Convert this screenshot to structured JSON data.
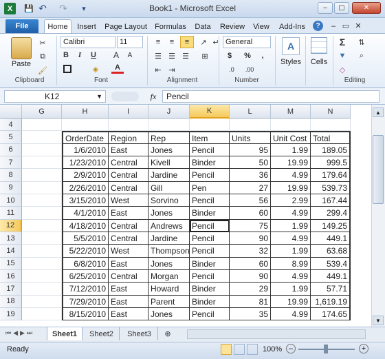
{
  "window": {
    "title": "Book1 - Microsoft Excel"
  },
  "quick_access": {
    "save": "💾",
    "undo": "↶",
    "redo": "↷",
    "customize": "▾"
  },
  "ribbon_tabs": [
    "File",
    "Home",
    "Insert",
    "Page Layout",
    "Formulas",
    "Data",
    "Review",
    "View",
    "Add-Ins"
  ],
  "ribbon": {
    "paste_label": "Paste",
    "font_name": "Calibri",
    "font_size": "11",
    "number_format": "General",
    "styles_label": "Styles",
    "cells_label": "Cells",
    "groups": [
      "Clipboard",
      "Font",
      "Alignment",
      "Number",
      "Editing"
    ]
  },
  "formula_bar": {
    "name_box": "K12",
    "fx": "fx",
    "value": "Pencil"
  },
  "columns": [
    "G",
    "H",
    "I",
    "J",
    "K",
    "L",
    "M",
    "N"
  ],
  "selected_column": "K",
  "rows": [
    "4",
    "5",
    "6",
    "7",
    "8",
    "9",
    "10",
    "11",
    "12",
    "13",
    "14",
    "15",
    "16",
    "17",
    "18",
    "19"
  ],
  "selected_row": "12",
  "table": {
    "headers": [
      "OrderDate",
      "Region",
      "Rep",
      "Item",
      "Units",
      "Unit Cost",
      "Total"
    ],
    "data": [
      [
        "1/6/2010",
        "East",
        "Jones",
        "Pencil",
        "95",
        "1.99",
        "189.05"
      ],
      [
        "1/23/2010",
        "Central",
        "Kivell",
        "Binder",
        "50",
        "19.99",
        "999.5"
      ],
      [
        "2/9/2010",
        "Central",
        "Jardine",
        "Pencil",
        "36",
        "4.99",
        "179.64"
      ],
      [
        "2/26/2010",
        "Central",
        "Gill",
        "Pen",
        "27",
        "19.99",
        "539.73"
      ],
      [
        "3/15/2010",
        "West",
        "Sorvino",
        "Pencil",
        "56",
        "2.99",
        "167.44"
      ],
      [
        "4/1/2010",
        "East",
        "Jones",
        "Binder",
        "60",
        "4.99",
        "299.4"
      ],
      [
        "4/18/2010",
        "Central",
        "Andrews",
        "Pencil",
        "75",
        "1.99",
        "149.25"
      ],
      [
        "5/5/2010",
        "Central",
        "Jardine",
        "Pencil",
        "90",
        "4.99",
        "449.1"
      ],
      [
        "5/22/2010",
        "West",
        "Thompson",
        "Pencil",
        "32",
        "1.99",
        "63.68"
      ],
      [
        "6/8/2010",
        "East",
        "Jones",
        "Binder",
        "60",
        "8.99",
        "539.4"
      ],
      [
        "6/25/2010",
        "Central",
        "Morgan",
        "Pencil",
        "90",
        "4.99",
        "449.1"
      ],
      [
        "7/12/2010",
        "East",
        "Howard",
        "Binder",
        "29",
        "1.99",
        "57.71"
      ],
      [
        "7/29/2010",
        "East",
        "Parent",
        "Binder",
        "81",
        "19.99",
        "1,619.19"
      ],
      [
        "8/15/2010",
        "East",
        "Jones",
        "Pencil",
        "35",
        "4.99",
        "174.65"
      ]
    ]
  },
  "sheets": [
    "Sheet1",
    "Sheet2",
    "Sheet3"
  ],
  "active_sheet": "Sheet1",
  "status": {
    "ready": "Ready",
    "zoom": "100%"
  }
}
